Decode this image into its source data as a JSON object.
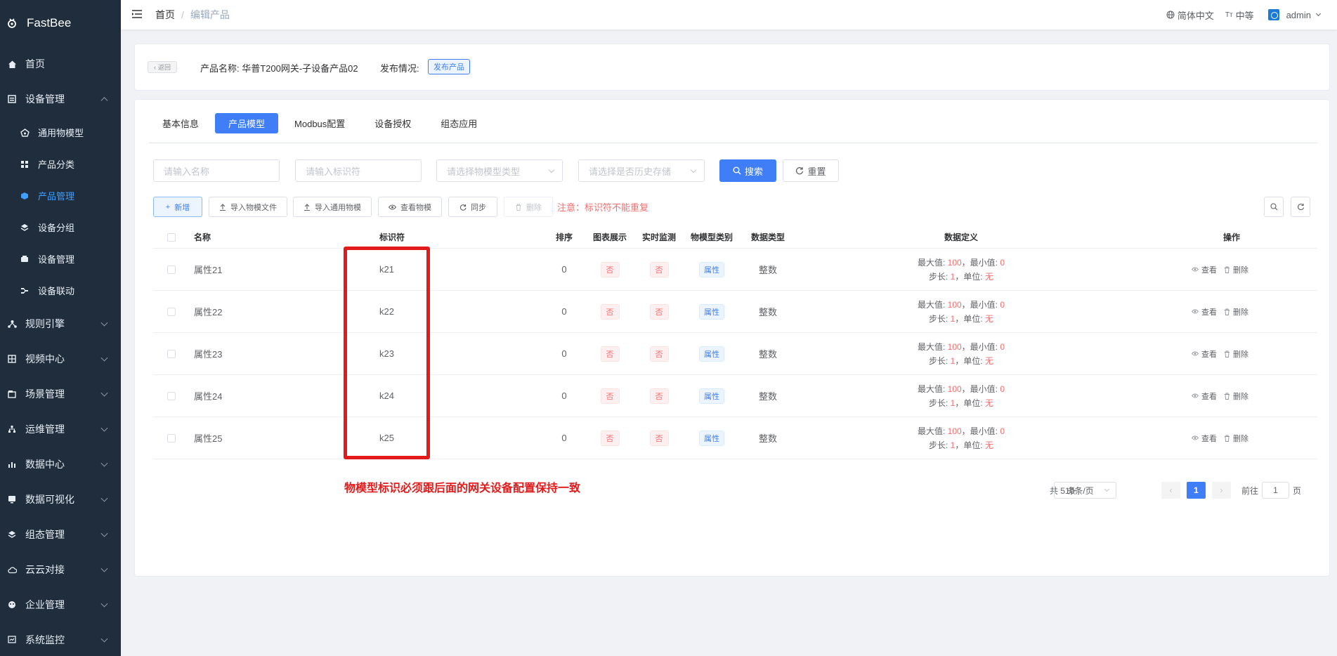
{
  "app": {
    "name": "FastBee"
  },
  "sidebar": {
    "items": [
      {
        "label": "首页",
        "icon": "home-icon"
      },
      {
        "label": "设备管理",
        "icon": "device-icon",
        "expanded": true,
        "children": [
          {
            "label": "通用物模型",
            "icon": "thing-model-icon"
          },
          {
            "label": "产品分类",
            "icon": "category-icon"
          },
          {
            "label": "产品管理",
            "icon": "product-icon",
            "active": true
          },
          {
            "label": "设备分组",
            "icon": "group-icon"
          },
          {
            "label": "设备管理",
            "icon": "device-manage-icon"
          },
          {
            "label": "设备联动",
            "icon": "linkage-icon"
          }
        ]
      },
      {
        "label": "规则引擎",
        "icon": "rule-icon"
      },
      {
        "label": "视频中心",
        "icon": "video-icon"
      },
      {
        "label": "场景管理",
        "icon": "scene-icon"
      },
      {
        "label": "运维管理",
        "icon": "ops-icon"
      },
      {
        "label": "数据中心",
        "icon": "data-icon"
      },
      {
        "label": "数据可视化",
        "icon": "visual-icon"
      },
      {
        "label": "组态管理",
        "icon": "config-icon"
      },
      {
        "label": "云云对接",
        "icon": "cloud-icon"
      },
      {
        "label": "企业管理",
        "icon": "enterprise-icon"
      },
      {
        "label": "系统监控",
        "icon": "monitor-icon"
      }
    ]
  },
  "header": {
    "breadcrumb": [
      "首页",
      "编辑产品"
    ],
    "language": "简体中文",
    "font_size": "中等",
    "user": "admin"
  },
  "product": {
    "back_label": "返回",
    "name_text": "产品名称: 华普T200网关-子设备产品02",
    "publish_label": "发布情况:",
    "publish_button": "发布产品"
  },
  "tabs": [
    "基本信息",
    "产品模型",
    "Modbus配置",
    "设备授权",
    "组态应用"
  ],
  "active_tab": 1,
  "filters": {
    "name_placeholder": "请输入名称",
    "identifier_placeholder": "请输入标识符",
    "type_placeholder": "请选择物模型类型",
    "history_placeholder": "请选择是否历史存储",
    "search_label": "搜索",
    "reset_label": "重置"
  },
  "toolbar": {
    "add": "新增",
    "import_file": "导入物模文件",
    "import_generic": "导入通用物模",
    "view_model": "查看物模",
    "sync": "同步",
    "delete": "删除",
    "note": "注意：标识符不能重复"
  },
  "table": {
    "columns": [
      "名称",
      "标识符",
      "排序",
      "图表展示",
      "实时监测",
      "物模型类别",
      "数据类型",
      "数据定义",
      "操作"
    ],
    "rows": [
      {
        "name": "属性21",
        "identifier": "k21",
        "order": "0",
        "chart": "否",
        "monitor": "否",
        "category": "属性",
        "dtype": "整数",
        "max": "100",
        "min": "0",
        "step": "1",
        "unit": "无"
      },
      {
        "name": "属性22",
        "identifier": "k22",
        "order": "0",
        "chart": "否",
        "monitor": "否",
        "category": "属性",
        "dtype": "整数",
        "max": "100",
        "min": "0",
        "step": "1",
        "unit": "无"
      },
      {
        "name": "属性23",
        "identifier": "k23",
        "order": "0",
        "chart": "否",
        "monitor": "否",
        "category": "属性",
        "dtype": "整数",
        "max": "100",
        "min": "0",
        "step": "1",
        "unit": "无"
      },
      {
        "name": "属性24",
        "identifier": "k24",
        "order": "0",
        "chart": "否",
        "monitor": "否",
        "category": "属性",
        "dtype": "整数",
        "max": "100",
        "min": "0",
        "step": "1",
        "unit": "无"
      },
      {
        "name": "属性25",
        "identifier": "k25",
        "order": "0",
        "chart": "否",
        "monitor": "否",
        "category": "属性",
        "dtype": "整数",
        "max": "100",
        "min": "0",
        "step": "1",
        "unit": "无"
      }
    ],
    "def_labels": {
      "max": "最大值: ",
      "min": "，最小值: ",
      "step": "步长: ",
      "unit": "，单位: "
    },
    "actions": {
      "view": "查看",
      "delete": "删除"
    }
  },
  "annotation": "物模型标识必须跟后面的网关设备配置保持一致",
  "pagination": {
    "total": "共 5 条",
    "page_size": "10条/页",
    "current": "1",
    "goto_label": "前往",
    "goto_value": "1",
    "page_suffix": "页"
  },
  "colors": {
    "primary": "#3f7ef6",
    "danger": "#f56c6c",
    "sidebar": "#1f2d3d",
    "annotation": "#e11b1b"
  }
}
